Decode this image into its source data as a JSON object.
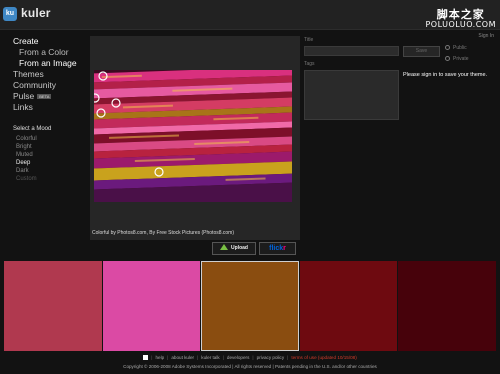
{
  "header": {
    "logo_badge": "ku",
    "app_name": "kuler",
    "watermark_cn": "脚本之家",
    "watermark_en": "POLUOLUO.COM",
    "sign_in": "Sign In"
  },
  "nav": {
    "create": "Create",
    "from_color": "From a Color",
    "from_image": "From an Image",
    "themes": "Themes",
    "community": "Community",
    "pulse": "Pulse",
    "pulse_badge": "BETA",
    "links": "Links"
  },
  "mood": {
    "title": "Select a Mood",
    "items": [
      {
        "label": "Colorful",
        "state": "normal"
      },
      {
        "label": "Bright",
        "state": "normal"
      },
      {
        "label": "Muted",
        "state": "normal"
      },
      {
        "label": "Deep",
        "state": "active"
      },
      {
        "label": "Dark",
        "state": "normal"
      },
      {
        "label": "Custom",
        "state": "dim"
      }
    ]
  },
  "image_panel": {
    "caption": "Colorful by Photos8.com, By Free Stock Pictures (Photos8.com)"
  },
  "buttons": {
    "upload": "Upload",
    "flickr_a": "flick",
    "flickr_b": "r"
  },
  "form": {
    "title_label": "Title",
    "tags_label": "Tags",
    "save": "Save",
    "public": "Public",
    "private": "Private",
    "signin_msg": "Please sign in to save your theme."
  },
  "swatches": [
    {
      "color": "#b0394f"
    },
    {
      "color": "#db4aa4"
    },
    {
      "color": "#8a4d10"
    },
    {
      "color": "#6e0a10"
    },
    {
      "color": "#47020b"
    }
  ],
  "footer": {
    "help": "help",
    "about": "about kuler",
    "talk": "kuler talk",
    "developers": "developers",
    "privacy": "privacy policy",
    "terms": "terms of use (updated 10/15/08)",
    "copyright": "Copyright © 2006-2008 Adobe Systems Incorporated | All rights reserved | Patents pending in the U.S. and/or other countries"
  },
  "colors": {
    "background": "#121212",
    "panel": "#262626",
    "upload_arrow": "#79c043",
    "flickr_blue": "#0063dc",
    "flickr_pink": "#ff0084",
    "terms_red": "#d23a2a"
  }
}
